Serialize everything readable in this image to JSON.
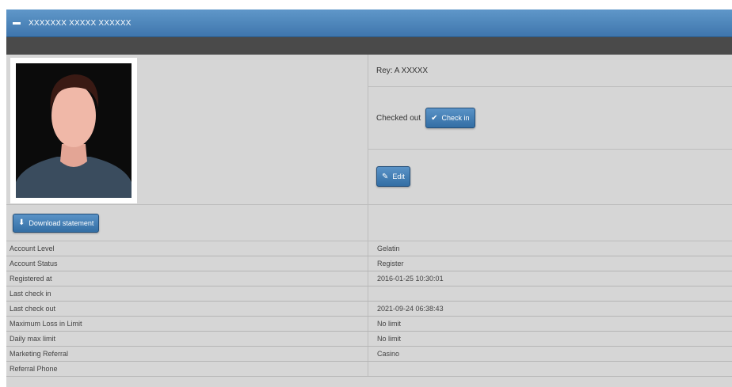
{
  "panel": {
    "title": "XXXXXXX XXXXX XXXXXX"
  },
  "profile": {
    "reference": "Rey: A XXXXX",
    "checkout_label": "Checked out",
    "checkin_button": "Check in",
    "edit_button": "Edit",
    "download_button": "Download statement"
  },
  "details": {
    "rows": [
      {
        "label": "Account Level",
        "value": "Gelatin"
      },
      {
        "label": "Account Status",
        "value": "Register"
      },
      {
        "label": "Registered at",
        "value": "2016-01-25 10:30:01"
      },
      {
        "label": "Last check in",
        "value": ""
      },
      {
        "label": "Last check out",
        "value": "2021-09-24 06:38:43"
      },
      {
        "label": "Maximum Loss in Limit",
        "value": "No limit"
      },
      {
        "label": "Daily max limit",
        "value": "No limit"
      },
      {
        "label": "Marketing Referral",
        "value": "Casino"
      },
      {
        "label": "Referral Phone",
        "value": ""
      }
    ]
  },
  "colors": {
    "titlebar": "#4a84bb",
    "button": "#3f7bb3",
    "panel_bg": "#d6d6d6"
  }
}
